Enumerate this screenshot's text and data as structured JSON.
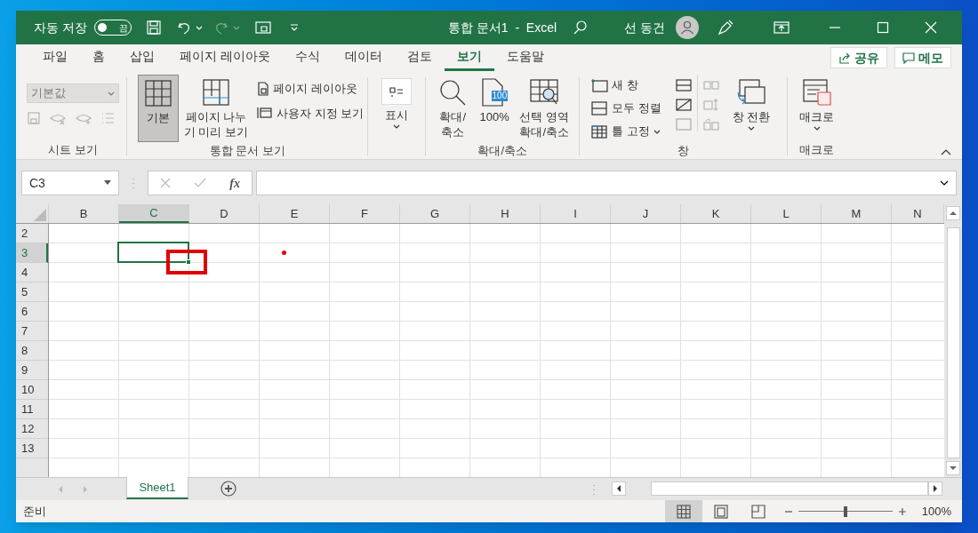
{
  "title_bar": {
    "autosave_label": "자동 저장",
    "autosave_toggle": {
      "label": "끔",
      "on": false
    },
    "title": "통합 문서1  -  Excel",
    "user": "선 동건"
  },
  "tabs": [
    {
      "label": "파일",
      "selected": false
    },
    {
      "label": "홈",
      "selected": false
    },
    {
      "label": "삽입",
      "selected": false
    },
    {
      "label": "페이지 레이아웃",
      "selected": false
    },
    {
      "label": "수식",
      "selected": false
    },
    {
      "label": "데이터",
      "selected": false
    },
    {
      "label": "검토",
      "selected": false
    },
    {
      "label": "보기",
      "selected": true
    },
    {
      "label": "도움말",
      "selected": false
    }
  ],
  "share_button": "공유",
  "comments_button": "메모",
  "ribbon": [
    {
      "label": "시트 보기",
      "view_dropdown": {
        "value": "기본값",
        "disabled": true
      }
    },
    {
      "label": "통합 문서 보기",
      "large_buttons": [
        {
          "lines": [
            "기본"
          ],
          "selected": true
        },
        {
          "lines": [
            "페이지 나누",
            "기 미리 보기"
          ],
          "selected": false
        }
      ],
      "small_buttons": [
        "페이지 레이아웃",
        "사용자 지정 보기"
      ]
    },
    {
      "large_buttons": [
        {
          "lines": [
            "표시"
          ],
          "selected": false
        }
      ]
    },
    {
      "label": "확대/축소",
      "large_buttons": [
        {
          "lines": [
            "확대/",
            "축소"
          ],
          "selected": false
        },
        {
          "lines": [
            "100%"
          ],
          "selected": false,
          "badge": "100"
        },
        {
          "lines": [
            "선택 영역",
            "확대/축소"
          ],
          "selected": false
        }
      ]
    },
    {
      "label": "창",
      "small_buttons": [
        "새 창",
        "모두 정렬",
        "틀 고정"
      ],
      "large_buttons": [
        {
          "lines": [
            "창 전환"
          ],
          "selected": false
        }
      ]
    },
    {
      "label": "매크로",
      "large_buttons": [
        {
          "lines": [
            "매크로"
          ],
          "selected": false
        }
      ]
    }
  ],
  "formula_bar": {
    "name_box": "C3",
    "function_label": "fx"
  },
  "columns": [
    {
      "label": "B",
      "selected": false
    },
    {
      "label": "C",
      "selected": true
    },
    {
      "label": "D",
      "selected": false
    },
    {
      "label": "E",
      "selected": false
    },
    {
      "label": "F",
      "selected": false
    },
    {
      "label": "G",
      "selected": false
    },
    {
      "label": "H",
      "selected": false
    },
    {
      "label": "I",
      "selected": false
    },
    {
      "label": "J",
      "selected": false
    },
    {
      "label": "K",
      "selected": false
    },
    {
      "label": "L",
      "selected": false
    },
    {
      "label": "M",
      "selected": false
    },
    {
      "label": "N",
      "selected": false
    }
  ],
  "rows": [
    {
      "label": "2",
      "selected": false
    },
    {
      "label": "3",
      "selected": true
    },
    {
      "label": "4",
      "selected": false
    },
    {
      "label": "5",
      "selected": false
    },
    {
      "label": "6",
      "selected": false
    },
    {
      "label": "7",
      "selected": false
    },
    {
      "label": "8",
      "selected": false
    },
    {
      "label": "9",
      "selected": false
    },
    {
      "label": "10",
      "selected": false
    },
    {
      "label": "11",
      "selected": false
    },
    {
      "label": "12",
      "selected": false
    },
    {
      "label": "13",
      "selected": false
    }
  ],
  "sheets": [
    {
      "label": "Sheet1",
      "selected": true
    }
  ],
  "status_bar": {
    "status": "준비",
    "views": [
      {
        "kind": "normal",
        "selected": true
      },
      {
        "kind": "page_layout",
        "selected": false
      },
      {
        "kind": "page_break",
        "selected": false
      }
    ],
    "zoom": {
      "level": 0.5,
      "label": "100%"
    }
  }
}
